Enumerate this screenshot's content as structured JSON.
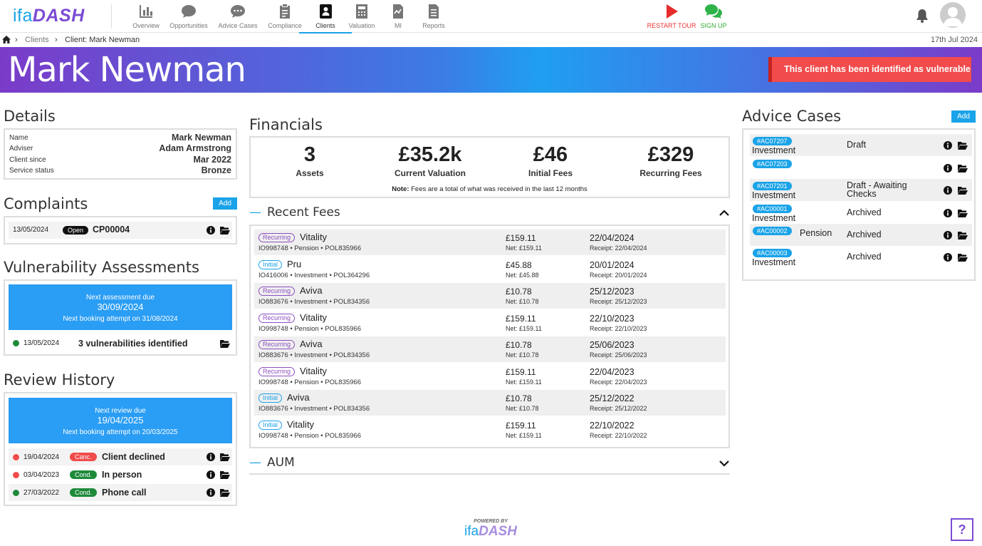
{
  "app": {
    "logo_a": "ifa",
    "logo_b": "DASH"
  },
  "nav": [
    {
      "label": "Overview",
      "icon": "chart-icon"
    },
    {
      "label": "Opportunities",
      "icon": "chat-bubble-icon"
    },
    {
      "label": "Advice Cases",
      "icon": "comments-icon"
    },
    {
      "label": "Compliance",
      "icon": "clipboard-icon"
    },
    {
      "label": "Clients",
      "icon": "contact-book-icon",
      "active": true
    },
    {
      "label": "Valuation",
      "icon": "calculator-icon"
    },
    {
      "label": "MI",
      "icon": "file-chart-icon"
    },
    {
      "label": "Reports",
      "icon": "document-icon"
    }
  ],
  "tour_label": "RESTART TOUR",
  "signup_label": "SIGN UP",
  "breadcrumb": {
    "items": [
      "Clients",
      "Client: Mark Newman"
    ],
    "date": "17th Jul 2024"
  },
  "client": {
    "name": "Mark Newman",
    "vulnerable_notice": "This client has been identified as vulnerable"
  },
  "details": {
    "title": "Details",
    "rows": [
      {
        "label": "Name",
        "value": "Mark Newman"
      },
      {
        "label": "Adviser",
        "value": "Adam Armstrong"
      },
      {
        "label": "Client since",
        "value": "Mar 2022"
      },
      {
        "label": "Service status",
        "value": "Bronze"
      }
    ]
  },
  "complaints": {
    "title": "Complaints",
    "add_label": "Add",
    "items": [
      {
        "date": "13/05/2024",
        "status": "Open",
        "ref": "CP00004"
      }
    ]
  },
  "vulnerability": {
    "title": "Vulnerability Assessments",
    "next_label": "Next assessment due",
    "next_date": "30/09/2024",
    "booking": "Next booking attempt on 31/08/2024",
    "items": [
      {
        "date": "13/05/2024",
        "text": "3 vulnerabilities identified"
      }
    ]
  },
  "review": {
    "title": "Review History",
    "next_label": "Next review due",
    "next_date": "19/04/2025",
    "booking": "Next booking attempt on 20/03/2025",
    "items": [
      {
        "date": "19/04/2024",
        "badge": "Canc.",
        "badge_color": "#f24b4b",
        "dot_color": "#f24b4b",
        "text": "Client declined"
      },
      {
        "date": "03/04/2023",
        "badge": "Cond.",
        "badge_color": "#1e8a3a",
        "dot_color": "#f24b4b",
        "text": "In person"
      },
      {
        "date": "27/03/2022",
        "badge": "Cond.",
        "badge_color": "#1e8a3a",
        "dot_color": "#1e8a3a",
        "text": "Phone call"
      }
    ]
  },
  "financials": {
    "title": "Financials",
    "stats": [
      {
        "value": "3",
        "label": "Assets"
      },
      {
        "value": "£35.2k",
        "label": "Current Valuation"
      },
      {
        "value": "£46",
        "label": "Initial Fees"
      },
      {
        "value": "£329",
        "label": "Recurring Fees"
      }
    ],
    "note_bold": "Note:",
    "note": "Fees are a total of what was received in the last 12 months"
  },
  "recent_fees": {
    "title": "Recent Fees",
    "rows": [
      {
        "type": "Recurring",
        "provider": "Vitality",
        "ref": "IO998748 • Pension • POL835966",
        "amount": "£159.11",
        "net": "Net: £159.11",
        "date": "22/04/2024",
        "receipt": "Receipt: 22/04/2024"
      },
      {
        "type": "Initial",
        "provider": "Pru",
        "ref": "IO416006 • Investment • POL364296",
        "amount": "£45.88",
        "net": "Net: £45.88",
        "date": "20/01/2024",
        "receipt": "Receipt: 20/01/2024"
      },
      {
        "type": "Recurring",
        "provider": "Aviva",
        "ref": "IO883676 • Investment • POL834356",
        "amount": "£10.78",
        "net": "Net: £10.78",
        "date": "25/12/2023",
        "receipt": "Receipt: 25/12/2023"
      },
      {
        "type": "Recurring",
        "provider": "Vitality",
        "ref": "IO998748 • Pension • POL835966",
        "amount": "£159.11",
        "net": "Net: £159.11",
        "date": "22/10/2023",
        "receipt": "Receipt: 22/10/2023"
      },
      {
        "type": "Recurring",
        "provider": "Aviva",
        "ref": "IO883676 • Investment • POL834356",
        "amount": "£10.78",
        "net": "Net: £10.78",
        "date": "25/06/2023",
        "receipt": "Receipt: 25/06/2023"
      },
      {
        "type": "Recurring",
        "provider": "Vitality",
        "ref": "IO998748 • Pension • POL835966",
        "amount": "£159.11",
        "net": "Net: £159.11",
        "date": "22/04/2023",
        "receipt": "Receipt: 22/04/2023"
      },
      {
        "type": "Initial",
        "provider": "Aviva",
        "ref": "IO883676 • Investment • POL834356",
        "amount": "£10.78",
        "net": "Net: £10.78",
        "date": "25/12/2022",
        "receipt": "Receipt: 25/12/2022"
      },
      {
        "type": "Initial",
        "provider": "Vitality",
        "ref": "IO998748 • Pension • POL835966",
        "amount": "£159.11",
        "net": "Net: £159.11",
        "date": "22/10/2022",
        "receipt": "Receipt: 22/10/2022"
      }
    ]
  },
  "aum": {
    "title": "AUM"
  },
  "advice_cases": {
    "title": "Advice Cases",
    "add_label": "Add",
    "items": [
      {
        "id": "#AC07207",
        "type": "Investment",
        "status": "Draft"
      },
      {
        "id": "#AC07203",
        "type": "",
        "status": ""
      },
      {
        "id": "#AC07201",
        "type": "Investment",
        "status": "Draft - Awaiting Checks"
      },
      {
        "id": "#AC00001",
        "type": "Investment",
        "status": "Archived"
      },
      {
        "id": "#AC00002",
        "type": "Pension",
        "status": "Archived"
      },
      {
        "id": "#AC00003",
        "type": "Investment",
        "status": "Archived"
      }
    ]
  },
  "footer": {
    "powered_by": "POWERED BY",
    "help": "?"
  }
}
